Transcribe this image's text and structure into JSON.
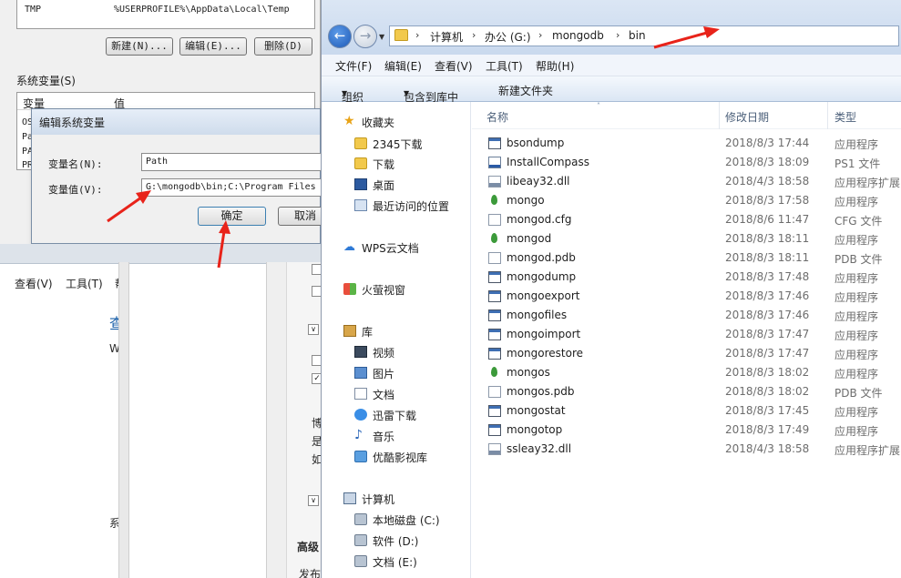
{
  "env_window": {
    "user_var_row": {
      "name": "TMP",
      "value": "%USERPROFILE%\\AppData\\Local\\Temp"
    },
    "buttons": {
      "new": "新建(N)...",
      "edit": "编辑(E)...",
      "delete": "删除(D)"
    },
    "system_vars_label": "系统变量(S)",
    "columns": {
      "var": "变量",
      "val": "值"
    },
    "rows": [
      "OS",
      "Pa",
      "PA",
      "PR"
    ]
  },
  "edit_dialog": {
    "title": "编辑系统变量",
    "name_label": "变量名(N):",
    "name_value": "Path",
    "value_label": "变量值(V):",
    "value_value": "G:\\mongodb\\bin;C:\\Program Files",
    "ok": "确定",
    "cancel": "取消"
  },
  "lower_window": {
    "menu": {
      "view": "查看(V)",
      "tools": "工具(T)",
      "more": "帮"
    },
    "heading": "查",
    "w": "W",
    "sys": "系",
    "right_chars": [
      "博",
      "是",
      "如"
    ],
    "advanced": "高级",
    "publish": "发布"
  },
  "explorer": {
    "breadcrumb": [
      "计算机",
      "办公 (G:)",
      "mongodb",
      "bin"
    ],
    "menu": [
      "文件(F)",
      "编辑(E)",
      "查看(V)",
      "工具(T)",
      "帮助(H)"
    ],
    "commands": {
      "organize": "组织",
      "include": "包含到库中",
      "new_folder": "新建文件夹"
    },
    "nav": {
      "favorites": "收藏夹",
      "fav_items": [
        "2345下载",
        "下载",
        "桌面",
        "最近访问的位置"
      ],
      "wps": "WPS云文档",
      "huoying": "火萤视窗",
      "library": "库",
      "lib_items": [
        "视频",
        "图片",
        "文档",
        "迅雷下载",
        "音乐",
        "优酷影视库"
      ],
      "computer": "计算机",
      "drives": [
        "本地磁盘 (C:)",
        "软件 (D:)",
        "文档 (E:)"
      ]
    },
    "columns": {
      "name": "名称",
      "date": "修改日期",
      "type": "类型"
    },
    "files": [
      {
        "name": "bsondump",
        "date": "2018/8/3 17:44",
        "type": "应用程序",
        "icon": "app"
      },
      {
        "name": "InstallCompass",
        "date": "2018/8/3 18:09",
        "type": "PS1 文件",
        "icon": "ps1"
      },
      {
        "name": "libeay32.dll",
        "date": "2018/4/3 18:58",
        "type": "应用程序扩展",
        "icon": "dll"
      },
      {
        "name": "mongo",
        "date": "2018/8/3 17:58",
        "type": "应用程序",
        "icon": "leaf"
      },
      {
        "name": "mongod.cfg",
        "date": "2018/8/6 11:47",
        "type": "CFG 文件",
        "icon": "file"
      },
      {
        "name": "mongod",
        "date": "2018/8/3 18:11",
        "type": "应用程序",
        "icon": "leaf"
      },
      {
        "name": "mongod.pdb",
        "date": "2018/8/3 18:11",
        "type": "PDB 文件",
        "icon": "file"
      },
      {
        "name": "mongodump",
        "date": "2018/8/3 17:48",
        "type": "应用程序",
        "icon": "app"
      },
      {
        "name": "mongoexport",
        "date": "2018/8/3 17:46",
        "type": "应用程序",
        "icon": "app"
      },
      {
        "name": "mongofiles",
        "date": "2018/8/3 17:46",
        "type": "应用程序",
        "icon": "app"
      },
      {
        "name": "mongoimport",
        "date": "2018/8/3 17:47",
        "type": "应用程序",
        "icon": "app"
      },
      {
        "name": "mongorestore",
        "date": "2018/8/3 17:47",
        "type": "应用程序",
        "icon": "app"
      },
      {
        "name": "mongos",
        "date": "2018/8/3 18:02",
        "type": "应用程序",
        "icon": "leaf"
      },
      {
        "name": "mongos.pdb",
        "date": "2018/8/3 18:02",
        "type": "PDB 文件",
        "icon": "file"
      },
      {
        "name": "mongostat",
        "date": "2018/8/3 17:45",
        "type": "应用程序",
        "icon": "app"
      },
      {
        "name": "mongotop",
        "date": "2018/8/3 17:49",
        "type": "应用程序",
        "icon": "app"
      },
      {
        "name": "ssleay32.dll",
        "date": "2018/4/3 18:58",
        "type": "应用程序扩展",
        "icon": "dll"
      }
    ]
  },
  "colors": {
    "arrow": "#e8231a",
    "accent": "#1d5ab8"
  }
}
